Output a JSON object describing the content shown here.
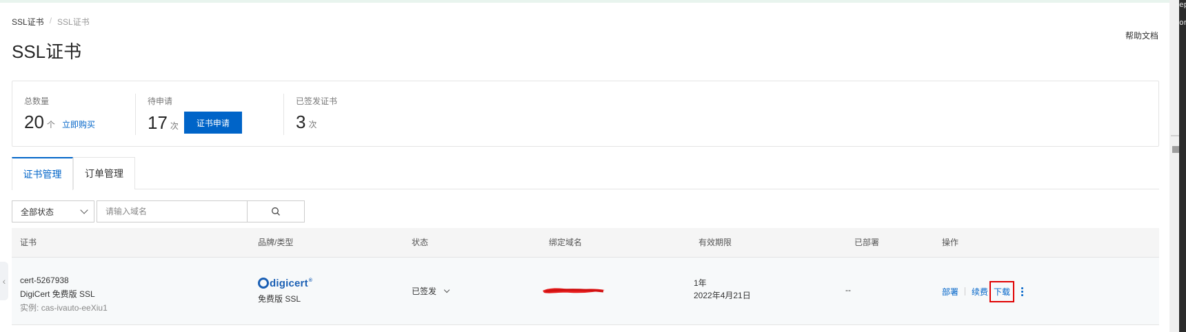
{
  "breadcrumb": [
    "SSL证书",
    "SSL证书"
  ],
  "breadcrumb_sep": "/",
  "help_link": "帮助文档",
  "page_title": "SSL证书",
  "stats": {
    "total": {
      "label": "总数量",
      "value": "20",
      "unit": "个",
      "link": "立即购买"
    },
    "pending": {
      "label": "待申请",
      "value": "17",
      "unit": "次",
      "button": "证书申请"
    },
    "issued": {
      "label": "已签发证书",
      "value": "3",
      "unit": "次"
    }
  },
  "tabs": [
    "证书管理",
    "订单管理"
  ],
  "filter": {
    "status_selected": "全部状态",
    "domain_placeholder": "请输入域名"
  },
  "table": {
    "columns": [
      "证书",
      "品牌/类型",
      "状态",
      "绑定域名",
      "有效期限",
      "已部署",
      "操作"
    ],
    "rows": [
      {
        "cert_id": "cert-5267938",
        "cert_name": "DigiCert 免费版 SSL",
        "instance_label": "实例:",
        "instance_id": "cas-ivauto-eeXiu1",
        "brand_logo": "digicert",
        "brand_type": "免费版 SSL",
        "status": "已签发",
        "validity_period": "1年",
        "validity_date": "2022年4月21日",
        "deployed": "--",
        "actions": [
          "部署",
          "续费",
          "下载"
        ]
      }
    ]
  },
  "right_fragments": [
    "epk",
    "on"
  ],
  "colors": {
    "accent": "#0064c8",
    "highlight_box": "#e00000",
    "redaction": "#e61e1e"
  }
}
